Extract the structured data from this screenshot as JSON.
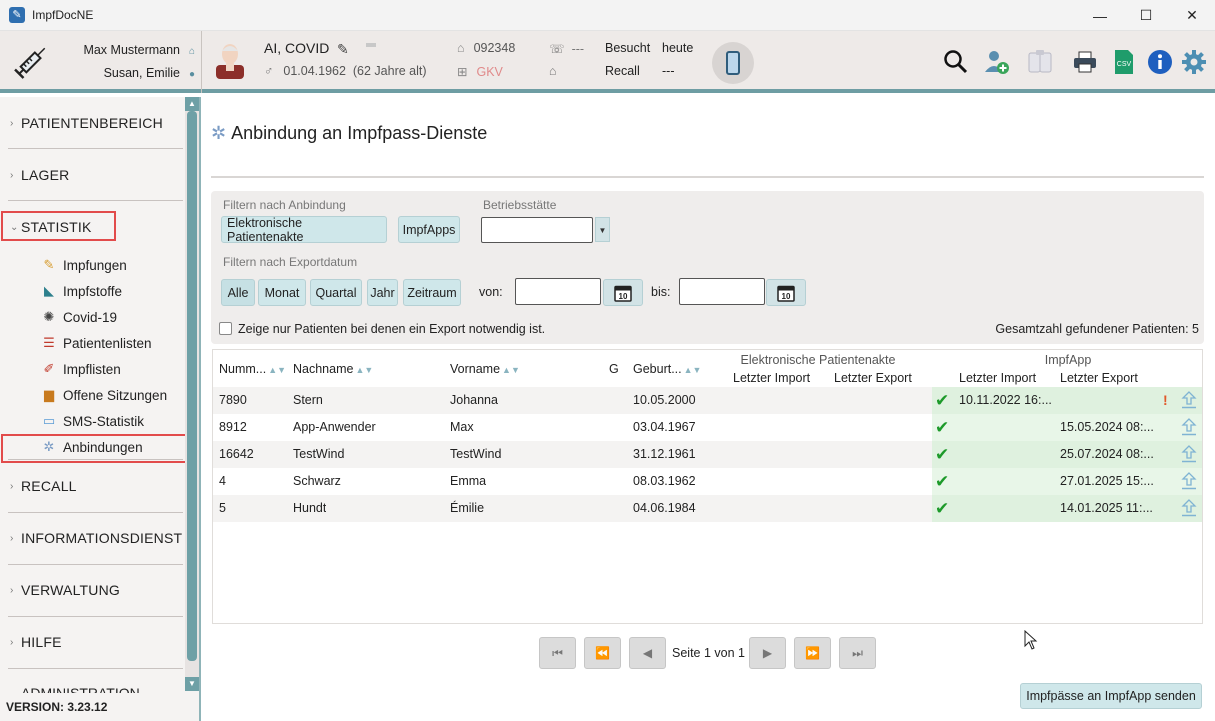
{
  "window": {
    "title": "ImpfDocNE",
    "controls": [
      "—",
      "☐",
      "✕"
    ]
  },
  "header": {
    "doctor": "Max Mustermann",
    "assistant": "Susan, Emilie",
    "patient": {
      "name": "AI, COVID",
      "dob": "01.04.1962",
      "age": "(62 Jahre alt)",
      "number": "092348",
      "insurance": "GKV",
      "phone": "---",
      "visited_label": "Besucht",
      "visited_value": "heute",
      "recall_label": "Recall",
      "recall_value": "---"
    },
    "toolbar_icons": [
      "search-icon",
      "add-patient-icon",
      "documents-icon",
      "print-icon",
      "csv-icon",
      "info-icon",
      "settings-icon"
    ],
    "csv_text": "CSV"
  },
  "sidebar": {
    "sections": [
      {
        "label": "PATIENTENBEREICH"
      },
      {
        "label": "LAGER"
      },
      {
        "label": "STATISTIK"
      },
      {
        "label": "RECALL"
      },
      {
        "label": "INFORMATIONSDIENST"
      },
      {
        "label": "VERWALTUNG"
      },
      {
        "label": "HILFE"
      },
      {
        "label": "ADMINISTRATION"
      }
    ],
    "statistik_items": [
      {
        "label": "Impfungen",
        "icon": "vaccinations-icon"
      },
      {
        "label": "Impfstoffe",
        "icon": "vaccine-icon"
      },
      {
        "label": "Covid-19",
        "icon": "virus-icon"
      },
      {
        "label": "Patientenlisten",
        "icon": "patient-list-icon"
      },
      {
        "label": "Impflisten",
        "icon": "syringe-list-icon"
      },
      {
        "label": "Offene Sitzungen",
        "icon": "open-sessions-icon"
      },
      {
        "label": "SMS-Statistik",
        "icon": "sms-icon"
      },
      {
        "label": "Anbindungen",
        "icon": "connections-icon"
      }
    ],
    "version": "VERSION: 3.23.12"
  },
  "main": {
    "title": "Anbindung an Impfpass-Dienste",
    "filters": {
      "connection_label": "Filtern nach Anbindung",
      "connection_buttons": [
        "Elektronische Patientenakte",
        "ImpfApps"
      ],
      "facility_label": "Betriebsstätte",
      "facility_value": "",
      "export_label": "Filtern nach Exportdatum",
      "period_buttons": [
        "Alle",
        "Monat",
        "Quartal",
        "Jahr",
        "Zeitraum"
      ],
      "from_label": "von:",
      "to_label": "bis:",
      "from_value": "",
      "to_value": "",
      "calendar_day": "10",
      "checkbox_label": "Zeige nur Patienten bei denen ein Export notwendig ist.",
      "total_text": "Gesamtzahl gefundener Patienten: 5"
    },
    "table": {
      "group_epa": "Elektronische Patientenakte",
      "group_app": "ImpfApp",
      "columns": {
        "number": "Numm...",
        "lastname": "Nachname",
        "firstname": "Vorname",
        "gender": "G",
        "birth": "Geburt...",
        "epa_import": "Letzter Import",
        "epa_export": "Letzter Export",
        "app_import": "Letzter Import",
        "app_export": "Letzter Export"
      },
      "rows": [
        {
          "number": "7890",
          "lastname": "Stern",
          "firstname": "Johanna",
          "gender": "",
          "birth": "10.05.2000",
          "app_check": true,
          "app_import": "10.11.2022 16:...",
          "app_export": "",
          "warn": true
        },
        {
          "number": "8912",
          "lastname": "App-Anwender",
          "firstname": "Max",
          "gender": "",
          "birth": "03.04.1967",
          "app_check": true,
          "app_import": "",
          "app_export": "15.05.2024 08:...",
          "warn": false
        },
        {
          "number": "16642",
          "lastname": "TestWind",
          "firstname": "TestWind",
          "gender": "",
          "birth": "31.12.1961",
          "app_check": true,
          "app_import": "",
          "app_export": "25.07.2024 08:...",
          "warn": false
        },
        {
          "number": "4",
          "lastname": "Schwarz",
          "firstname": "Emma",
          "gender": "",
          "birth": "08.03.1962",
          "app_check": true,
          "app_import": "",
          "app_export": "27.01.2025 15:...",
          "warn": false
        },
        {
          "number": "5",
          "lastname": "Hundt",
          "firstname": "Émilie",
          "gender": "",
          "birth": "04.06.1984",
          "app_check": true,
          "app_import": "",
          "app_export": "14.01.2025 11:...",
          "warn": false
        }
      ]
    },
    "pagination": {
      "label": "Seite 1 von 1"
    },
    "send_button": "Impfpässe an ImpfApp senden"
  }
}
